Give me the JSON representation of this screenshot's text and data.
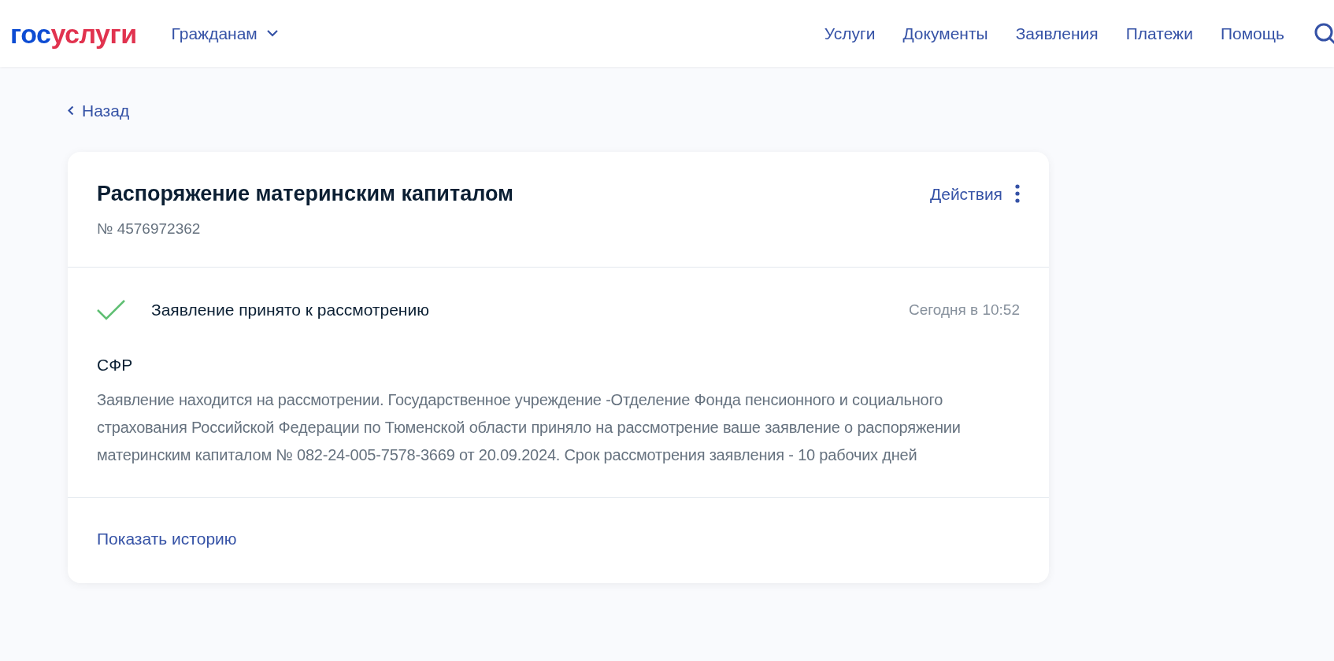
{
  "header": {
    "logo": {
      "prefix": "гос",
      "suffix": "услуги"
    },
    "audience": "Гражданам",
    "nav": [
      "Услуги",
      "Документы",
      "Заявления",
      "Платежи",
      "Помощь"
    ]
  },
  "back": "Назад",
  "card": {
    "title": "Распоряжение материнским капиталом",
    "number": "№ 4576972362",
    "actions": "Действия",
    "status": {
      "done": true,
      "label": "Заявление принято к рассмотрению",
      "time": "Сегодня в 10:52",
      "org": "СФР",
      "description": "Заявление находится на рассмотрении. Государственное учреждение -Отделение Фонда пенсионного и социального страхования Российской Федерации по Тюменской области приняло на рассмотрение ваше заявление о распоряжении материнским капиталом № 082-24-005-7578-3669 от 20.09.2024. Срок рассмотрения заявления - 10 рабочих дней"
    },
    "history_link": "Показать историю"
  }
}
